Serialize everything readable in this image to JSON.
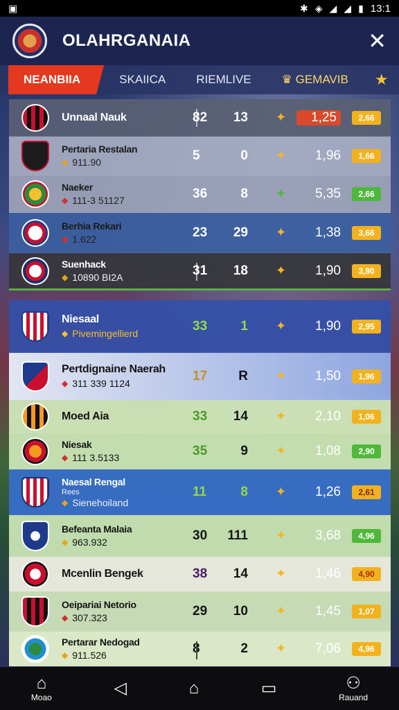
{
  "status": {
    "time": "13:1"
  },
  "app": {
    "title": "OLAHRGANAIA"
  },
  "tabs": [
    {
      "label": "NEANBIIA"
    },
    {
      "label": "SKAIICA"
    },
    {
      "label": "RIEMLIVE"
    },
    {
      "label": "GEMAVIB"
    }
  ],
  "rows": [
    {
      "name": "Unnaal Nauk",
      "sub": "",
      "h": "82",
      "a": "13",
      "odds": "1,25",
      "badge": "2,66",
      "badge_color": "#f2b21e",
      "odds_color": "#ff6a2a"
    },
    {
      "name": "Pertaria Restalan",
      "sub": "911.90",
      "h": "5",
      "a": "0",
      "odds": "1,96",
      "badge": "1,66",
      "badge_color": "#f2b21e"
    },
    {
      "name": "Naeker",
      "sub": "111-3 51127",
      "h": "36",
      "a": "8",
      "odds": "5,35",
      "badge": "2,66",
      "badge_color": "#4fb83a"
    },
    {
      "name": "Berhia Rekari",
      "sub": "1.622",
      "h": "23",
      "a": "29",
      "odds": "1,38",
      "badge": "3,66",
      "badge_color": "#f2b21e"
    },
    {
      "name": "Suenhack",
      "sub": "10890 BI2A",
      "h": "31",
      "a": "18",
      "odds": "1,90",
      "badge": "3,90",
      "badge_color": "#f2b21e"
    },
    {
      "name": "Niesaal",
      "sub": "Pivemingellierd",
      "h": "33",
      "a": "1",
      "odds": "1,90",
      "badge": "2,95",
      "badge_color": "#f2b21e"
    },
    {
      "name": "Pertdignaine Naerah",
      "sub": "311 339 1124",
      "h": "17",
      "a": "R",
      "odds": "1,50",
      "badge": "1,96",
      "badge_color": "#f2b21e"
    },
    {
      "name": "Moed Aia",
      "sub": "",
      "h": "33",
      "a": "14",
      "odds": "2,10",
      "badge": "1,06",
      "badge_color": "#f2b21e"
    },
    {
      "name": "Niesak",
      "sub": "111 3.5133",
      "h": "35",
      "a": "9",
      "odds": "1,08",
      "badge": "2,90",
      "badge_color": "#4fb83a"
    },
    {
      "name": "Naesal Rengal",
      "sub": "Sienehoiland",
      "sub2": "Rees",
      "h": "11",
      "a": "8",
      "odds": "1,26",
      "badge": "2,61",
      "badge_color": "#f2b21e"
    },
    {
      "name": "Befeanta Malaia",
      "sub": "963.932",
      "h": "30",
      "a": "111",
      "odds": "3,68",
      "badge": "4,96",
      "badge_color": "#4fb83a"
    },
    {
      "name": "Mcenlin Bengek",
      "sub": "",
      "h": "38",
      "a": "14",
      "odds": "1,46",
      "badge": "4,90",
      "badge_color": "#f2b21e"
    },
    {
      "name": "Oeipariai Netorio",
      "sub": "307.323",
      "h": "29",
      "a": "10",
      "odds": "1,45",
      "badge": "1,07",
      "badge_color": "#f2b21e"
    },
    {
      "name": "Pertarar Nedogad",
      "sub": "911.526",
      "h": "8",
      "a": "2",
      "odds": "7,06",
      "badge": "4,96",
      "badge_color": "#f2b21e"
    }
  ],
  "nav": {
    "home": "Moao",
    "profile": "Rauand"
  }
}
